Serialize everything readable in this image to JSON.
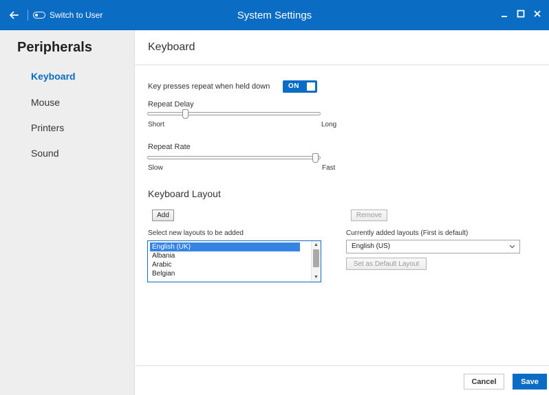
{
  "window": {
    "title": "System Settings",
    "switch_user_label": "Switch to User",
    "accent": "#0a6cc3"
  },
  "sidebar": {
    "title": "Peripherals",
    "items": [
      {
        "label": "Keyboard",
        "active": true
      },
      {
        "label": "Mouse",
        "active": false
      },
      {
        "label": "Printers",
        "active": false
      },
      {
        "label": "Sound",
        "active": false
      }
    ]
  },
  "main": {
    "title": "Keyboard",
    "repeat": {
      "label": "Key presses repeat when held down",
      "toggle_label": "ON",
      "enabled": true
    },
    "repeat_delay": {
      "label": "Repeat Delay",
      "min_label": "Short",
      "max_label": "Long",
      "value_fraction": 0.22
    },
    "repeat_rate": {
      "label": "Repeat Rate",
      "min_label": "Slow",
      "max_label": "Fast",
      "value_fraction": 0.97
    },
    "layout": {
      "section_title": "Keyboard Layout",
      "add_label": "Add",
      "remove_label": "Remove",
      "new_layouts_label": "Select new layouts to be added",
      "new_layouts": [
        "English (UK)",
        "Albania",
        "Arabic",
        "Belgian"
      ],
      "selected_new_layout": "English (UK)",
      "current_layouts_label": "Currently added layouts (First is default)",
      "current_layout_value": "English (US)",
      "set_default_label": "Set as Default Layout"
    }
  },
  "footer": {
    "cancel_label": "Cancel",
    "save_label": "Save"
  }
}
